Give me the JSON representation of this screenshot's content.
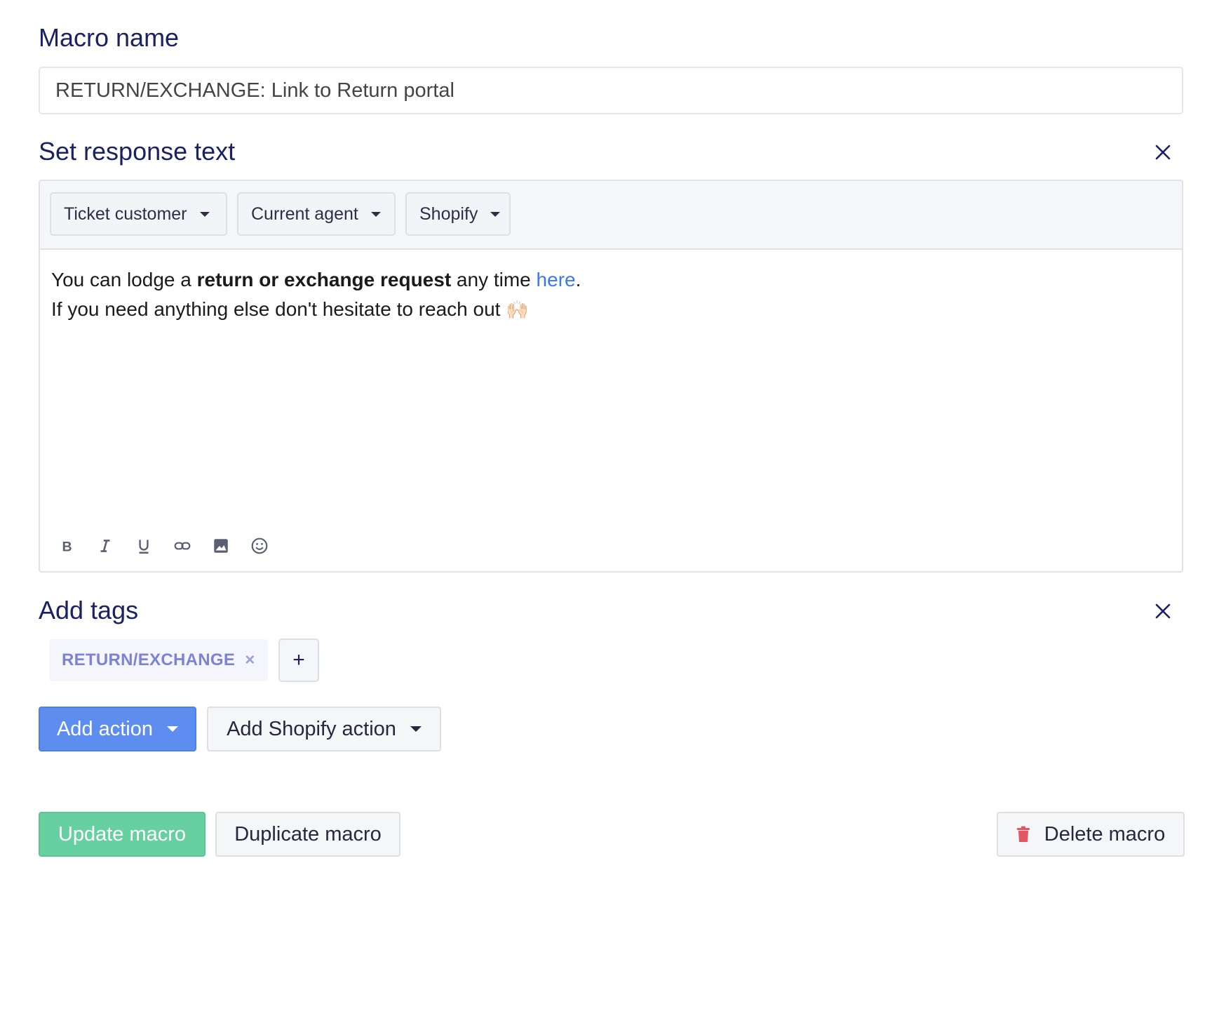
{
  "macro_name": {
    "label": "Macro name",
    "value": "RETURN/EXCHANGE: Link to Return portal"
  },
  "response": {
    "label": "Set response text",
    "variables": [
      {
        "label": "Ticket customer"
      },
      {
        "label": "Current agent"
      },
      {
        "label": "Shopify"
      }
    ],
    "line1_before": "You can lodge a ",
    "line1_bold": "return or exchange request",
    "line1_middle": " any time ",
    "line1_link": "here",
    "line1_after": ".",
    "line2": "If you need anything else don't hesitate to reach out ",
    "line2_emoji": "🙌🏻",
    "toolbar_icons": [
      "bold-icon",
      "italic-icon",
      "underline-icon",
      "link-icon",
      "image-icon",
      "emoji-icon"
    ]
  },
  "tags": {
    "label": "Add tags",
    "items": [
      "RETURN/EXCHANGE"
    ],
    "remove_symbol": "×",
    "add_symbol": "+"
  },
  "actions": {
    "add_action": "Add action",
    "add_shopify_action": "Add Shopify action"
  },
  "footer": {
    "update": "Update macro",
    "duplicate": "Duplicate macro",
    "delete": "Delete macro"
  },
  "colors": {
    "heading": "#1a2264",
    "primary": "#5d8eef",
    "success": "#67d0a0",
    "danger": "#e25563",
    "link": "#3a7ae8",
    "tag_text": "#7c83d6"
  }
}
